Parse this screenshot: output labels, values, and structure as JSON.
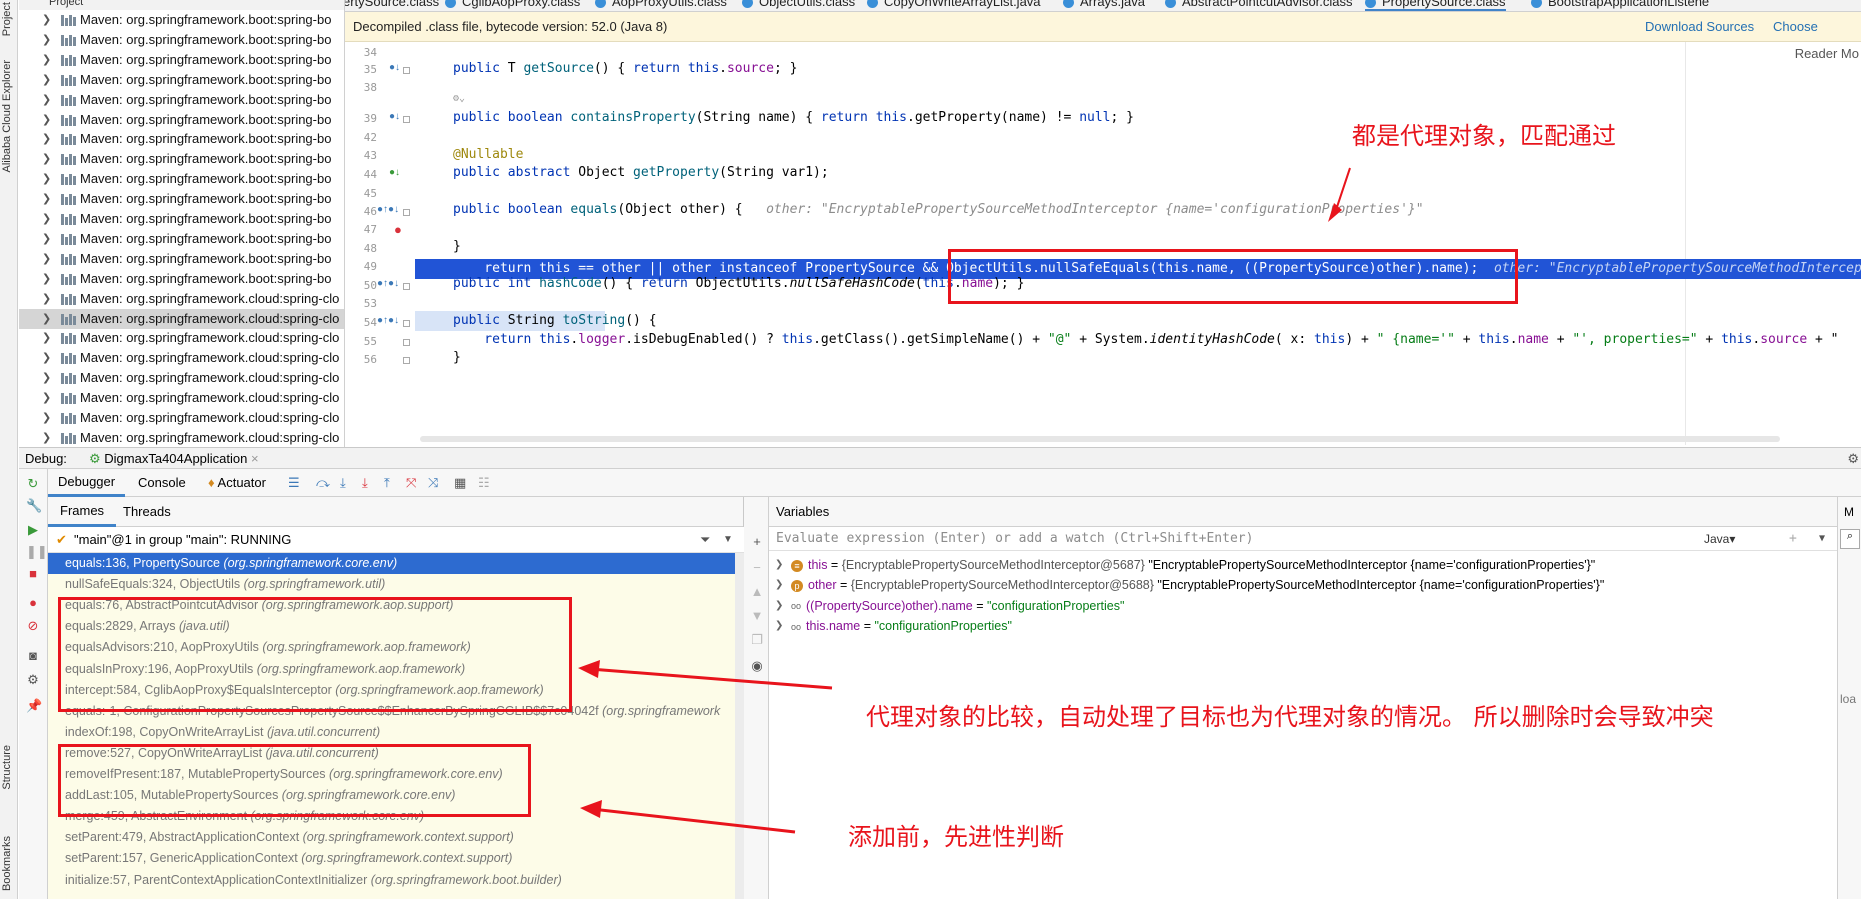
{
  "left_strip": {
    "project_tab": "Project",
    "alibaba_tab": "Alibaba Cloud Explorer",
    "structure_tab": "Structure",
    "bookmarks_tab": "Bookmarks"
  },
  "project_panel": {
    "header": "Project",
    "rows": [
      {
        "label": "Maven: org.springframework.boot:spring-bo"
      },
      {
        "label": "Maven: org.springframework.boot:spring-bo"
      },
      {
        "label": "Maven: org.springframework.boot:spring-bo"
      },
      {
        "label": "Maven: org.springframework.boot:spring-bo"
      },
      {
        "label": "Maven: org.springframework.boot:spring-bo"
      },
      {
        "label": "Maven: org.springframework.boot:spring-bo"
      },
      {
        "label": "Maven: org.springframework.boot:spring-bo"
      },
      {
        "label": "Maven: org.springframework.boot:spring-bo"
      },
      {
        "label": "Maven: org.springframework.boot:spring-bo"
      },
      {
        "label": "Maven: org.springframework.boot:spring-bo"
      },
      {
        "label": "Maven: org.springframework.boot:spring-bo"
      },
      {
        "label": "Maven: org.springframework.boot:spring-bo"
      },
      {
        "label": "Maven: org.springframework.boot:spring-bo"
      },
      {
        "label": "Maven: org.springframework.boot:spring-bo"
      },
      {
        "label": "Maven: org.springframework.cloud:spring-clo"
      },
      {
        "label": "Maven: org.springframework.cloud:spring-clo"
      },
      {
        "label": "Maven: org.springframework.cloud:spring-clo"
      },
      {
        "label": "Maven: org.springframework.cloud:spring-clo"
      },
      {
        "label": "Maven: org.springframework.cloud:spring-clo"
      },
      {
        "label": "Maven: org.springframework.cloud:spring-clo"
      },
      {
        "label": "Maven: org.springframework.cloud:spring-clo"
      },
      {
        "label": "Maven: org.springframework.cloud:spring-clo"
      }
    ]
  },
  "tabs": [
    "ertySource.class",
    "CglibAopProxy.class",
    "AopProxyUtils.class",
    "ObjectUtils.class",
    "CopyOnWriteArrayList.java",
    "Arrays.java",
    "AbstractPointcutAdvisor.class",
    "PropertySource.class",
    "BootstrapApplicationListene"
  ],
  "banner": {
    "text": "Decompiled .class file, bytecode version: 52.0 (Java 8)",
    "download_sources": "Download Sources",
    "choose_sources": "Choose Sources"
  },
  "editor": {
    "reader_mode": "Reader Mo",
    "line_numbers": [
      "34",
      "35",
      "38",
      "",
      "39",
      "42",
      "43",
      "44",
      "45",
      "46",
      "47",
      "48",
      "49",
      "50",
      "53",
      "54",
      "55",
      "56"
    ],
    "code": {
      "l35_kw1": "public",
      "l35_t": " T ",
      "l35_fn": "getSource",
      "l35_rest1": "() { ",
      "l35_kw2": "return",
      "l35_sp": " ",
      "l35_kw3": "this",
      "l35_dot": ".",
      "l35_fld": "source",
      "l35_end": "; }",
      "l39_kw1": "public",
      "l39_sp1": " ",
      "l39_kw2": "boolean",
      "l39_sp2": " ",
      "l39_fn": "containsProperty",
      "l39_mid": "(String name) { ",
      "l39_kw3": "return",
      "l39_sp3": " ",
      "l39_kw4": "this",
      "l39_mid2": ".getProperty(name) != ",
      "l39_kw5": "null",
      "l39_end": "; }",
      "l43_ann": "@Nullable",
      "l44_kw1": "public",
      "l44_sp": " ",
      "l44_kw2": "abstract",
      "l44_t": " Object ",
      "l44_fn": "getProperty",
      "l44_end": "(String var1);",
      "l46_kw1": "public",
      "l46_sp": " ",
      "l46_kw2": "boolean",
      "l46_sp2": " ",
      "l46_fn": "equals",
      "l46_end": "(Object other) {   ",
      "l46_hint": "other: \"EncryptablePropertySourceMethodInterceptor {name='configurationProperties'}\"",
      "l47_code": "    return this == other || other instanceof PropertySource && ObjectUtils.nullSafeEquals(this.name, ((PropertySource)other).name);",
      "l47_hint": "  other: \"EncryptablePropertySourceMethodInterceptor {name='configurationProperties'}\"",
      "l48_code": "}",
      "l50_kw1": "public",
      "l50_sp": " ",
      "l50_kw2": "int",
      "l50_sp2": " ",
      "l50_fn": "hashCode",
      "l50_mid": "() { ",
      "l50_kw3": "return",
      "l50_mid2": " ObjectUtils.",
      "l50_it": "nullSafeHashCode",
      "l50_mid3": "(",
      "l50_kw4": "this",
      "l50_dot": ".",
      "l50_fld": "name",
      "l50_end": "); }",
      "l54_kw1": "public",
      "l54_t": " String ",
      "l54_fn": "toString",
      "l54_end": "() {",
      "l55_kw1": "    return",
      "l55_sp": " ",
      "l55_kw2": "this",
      "l55_dot": ".",
      "l55_fld": "logger",
      "l55_mid": ".isDebugEnabled() ? ",
      "l55_kw3": "this",
      "l55_mid2": ".getClass().getSimpleName() + ",
      "l55_str1": "\"@\"",
      "l55_mid3": " + System.",
      "l55_it": "identityHashCode",
      "l55_mid4": "( x: ",
      "l55_kw4": "this",
      "l55_mid5": ") + ",
      "l55_str2": "\" {name='\"",
      "l55_mid6": " + ",
      "l55_kw5": "this",
      "l55_dot2": ".",
      "l55_fld2": "name",
      "l55_mid7": " + ",
      "l55_str3": "\"', properties=\"",
      "l55_mid8": " + ",
      "l55_kw6": "this",
      "l55_dot3": ".",
      "l55_fld3": "source",
      "l55_end": " + \"",
      "l56_code": "}"
    }
  },
  "debug": {
    "label": "Debug:",
    "session": "DigmaxTa404Application",
    "tabs": [
      "Debugger",
      "Console",
      "Actuator"
    ],
    "frames_tab": "Frames",
    "threads_tab": "Threads",
    "thread": "\"main\"@1 in group \"main\": RUNNING",
    "frames": [
      {
        "method": "equals:136, PropertySource ",
        "pkg": "(org.springframework.core.env)"
      },
      {
        "method": "nullSafeEquals:324, ObjectUtils ",
        "pkg": "(org.springframework.util)"
      },
      {
        "method": "equals:76, AbstractPointcutAdvisor ",
        "pkg": "(org.springframework.aop.support)"
      },
      {
        "method": "equals:2829, Arrays ",
        "pkg": "(java.util)"
      },
      {
        "method": "equalsAdvisors:210, AopProxyUtils ",
        "pkg": "(org.springframework.aop.framework)"
      },
      {
        "method": "equalsInProxy:196, AopProxyUtils ",
        "pkg": "(org.springframework.aop.framework)"
      },
      {
        "method": "intercept:584, CglibAopProxy$EqualsInterceptor ",
        "pkg": "(org.springframework.aop.framework)"
      },
      {
        "method": "equals:-1, ConfigurationPropertySourcesPropertySource$$EnhancerBySpringCGLIB$$7c04042f ",
        "pkg": "(org.springframework"
      },
      {
        "method": "indexOf:198, CopyOnWriteArrayList ",
        "pkg": "(java.util.concurrent)"
      },
      {
        "method": "remove:527, CopyOnWriteArrayList ",
        "pkg": "(java.util.concurrent)"
      },
      {
        "method": "removeIfPresent:187, MutablePropertySources ",
        "pkg": "(org.springframework.core.env)"
      },
      {
        "method": "addLast:105, MutablePropertySources ",
        "pkg": "(org.springframework.core.env)"
      },
      {
        "method": "merge:459, AbstractEnvironment ",
        "pkg": "(org.springframework.core.env)"
      },
      {
        "method": "setParent:479, AbstractApplicationContext ",
        "pkg": "(org.springframework.context.support)"
      },
      {
        "method": "setParent:157, GenericApplicationContext ",
        "pkg": "(org.springframework.context.support)"
      },
      {
        "method": "initialize:57, ParentContextApplicationContextInitializer ",
        "pkg": "(org.springframework.boot.builder)"
      }
    ],
    "variables_label": "Variables",
    "eval_placeholder": "Evaluate expression (Enter) or add a watch (Ctrl+Shift+Enter)",
    "eval_lang": "Java",
    "variables": [
      {
        "badge": "≡",
        "name": "this",
        "eq": " = ",
        "type": "{EncryptablePropertySourceMethodInterceptor@5687} ",
        "value": "\"EncryptablePropertySourceMethodInterceptor {name='configurationProperties'}\""
      },
      {
        "badge": "p",
        "name": "other",
        "eq": " = ",
        "type": "{EncryptablePropertySourceMethodInterceptor@5688} ",
        "value": "\"EncryptablePropertySourceMethodInterceptor {name='configurationProperties'}\""
      },
      {
        "badge": "oo",
        "name": "((PropertySource)other).name",
        "eq": " = ",
        "type": "",
        "value": "\"configurationProperties\""
      },
      {
        "badge": "oo",
        "name": "this.name",
        "eq": " = ",
        "type": "",
        "value": "\"configurationProperties\""
      }
    ],
    "far_right_text": "loa"
  },
  "annotations": {
    "proxy_match": "都是代理对象，匹配通过",
    "proxy_compare": "代理对象的比较，自动处理了目标也为代理对象的情况。  所以删除时会导致冲突",
    "before_add": "添加前，先进性判断"
  },
  "colors": {
    "annotation_red": "#e8141c",
    "exec_line": "#2154d6",
    "selected_frame": "#2d6bd0",
    "banner": "#fdf6dc",
    "link": "#2470b3"
  }
}
